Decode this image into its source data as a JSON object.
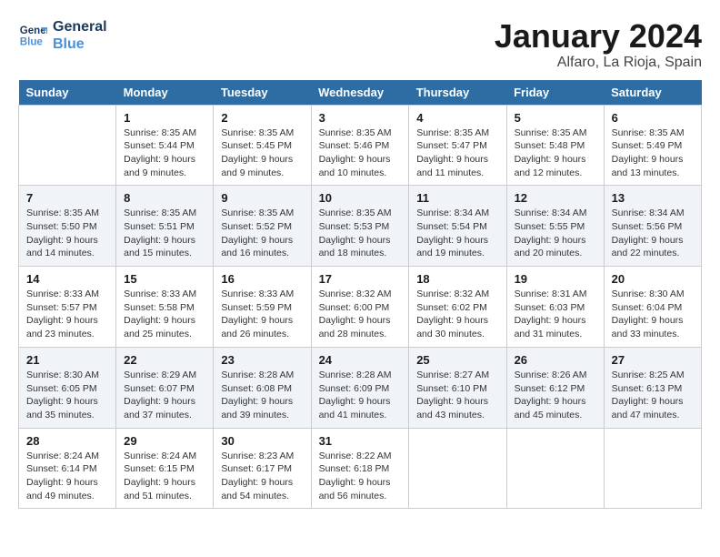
{
  "header": {
    "logo_line1": "General",
    "logo_line2": "Blue",
    "month_title": "January 2024",
    "location": "Alfaro, La Rioja, Spain"
  },
  "days_of_week": [
    "Sunday",
    "Monday",
    "Tuesday",
    "Wednesday",
    "Thursday",
    "Friday",
    "Saturday"
  ],
  "weeks": [
    [
      {
        "num": "",
        "info": ""
      },
      {
        "num": "1",
        "info": "Sunrise: 8:35 AM\nSunset: 5:44 PM\nDaylight: 9 hours\nand 9 minutes."
      },
      {
        "num": "2",
        "info": "Sunrise: 8:35 AM\nSunset: 5:45 PM\nDaylight: 9 hours\nand 9 minutes."
      },
      {
        "num": "3",
        "info": "Sunrise: 8:35 AM\nSunset: 5:46 PM\nDaylight: 9 hours\nand 10 minutes."
      },
      {
        "num": "4",
        "info": "Sunrise: 8:35 AM\nSunset: 5:47 PM\nDaylight: 9 hours\nand 11 minutes."
      },
      {
        "num": "5",
        "info": "Sunrise: 8:35 AM\nSunset: 5:48 PM\nDaylight: 9 hours\nand 12 minutes."
      },
      {
        "num": "6",
        "info": "Sunrise: 8:35 AM\nSunset: 5:49 PM\nDaylight: 9 hours\nand 13 minutes."
      }
    ],
    [
      {
        "num": "7",
        "info": "Sunrise: 8:35 AM\nSunset: 5:50 PM\nDaylight: 9 hours\nand 14 minutes."
      },
      {
        "num": "8",
        "info": "Sunrise: 8:35 AM\nSunset: 5:51 PM\nDaylight: 9 hours\nand 15 minutes."
      },
      {
        "num": "9",
        "info": "Sunrise: 8:35 AM\nSunset: 5:52 PM\nDaylight: 9 hours\nand 16 minutes."
      },
      {
        "num": "10",
        "info": "Sunrise: 8:35 AM\nSunset: 5:53 PM\nDaylight: 9 hours\nand 18 minutes."
      },
      {
        "num": "11",
        "info": "Sunrise: 8:34 AM\nSunset: 5:54 PM\nDaylight: 9 hours\nand 19 minutes."
      },
      {
        "num": "12",
        "info": "Sunrise: 8:34 AM\nSunset: 5:55 PM\nDaylight: 9 hours\nand 20 minutes."
      },
      {
        "num": "13",
        "info": "Sunrise: 8:34 AM\nSunset: 5:56 PM\nDaylight: 9 hours\nand 22 minutes."
      }
    ],
    [
      {
        "num": "14",
        "info": "Sunrise: 8:33 AM\nSunset: 5:57 PM\nDaylight: 9 hours\nand 23 minutes."
      },
      {
        "num": "15",
        "info": "Sunrise: 8:33 AM\nSunset: 5:58 PM\nDaylight: 9 hours\nand 25 minutes."
      },
      {
        "num": "16",
        "info": "Sunrise: 8:33 AM\nSunset: 5:59 PM\nDaylight: 9 hours\nand 26 minutes."
      },
      {
        "num": "17",
        "info": "Sunrise: 8:32 AM\nSunset: 6:00 PM\nDaylight: 9 hours\nand 28 minutes."
      },
      {
        "num": "18",
        "info": "Sunrise: 8:32 AM\nSunset: 6:02 PM\nDaylight: 9 hours\nand 30 minutes."
      },
      {
        "num": "19",
        "info": "Sunrise: 8:31 AM\nSunset: 6:03 PM\nDaylight: 9 hours\nand 31 minutes."
      },
      {
        "num": "20",
        "info": "Sunrise: 8:30 AM\nSunset: 6:04 PM\nDaylight: 9 hours\nand 33 minutes."
      }
    ],
    [
      {
        "num": "21",
        "info": "Sunrise: 8:30 AM\nSunset: 6:05 PM\nDaylight: 9 hours\nand 35 minutes."
      },
      {
        "num": "22",
        "info": "Sunrise: 8:29 AM\nSunset: 6:07 PM\nDaylight: 9 hours\nand 37 minutes."
      },
      {
        "num": "23",
        "info": "Sunrise: 8:28 AM\nSunset: 6:08 PM\nDaylight: 9 hours\nand 39 minutes."
      },
      {
        "num": "24",
        "info": "Sunrise: 8:28 AM\nSunset: 6:09 PM\nDaylight: 9 hours\nand 41 minutes."
      },
      {
        "num": "25",
        "info": "Sunrise: 8:27 AM\nSunset: 6:10 PM\nDaylight: 9 hours\nand 43 minutes."
      },
      {
        "num": "26",
        "info": "Sunrise: 8:26 AM\nSunset: 6:12 PM\nDaylight: 9 hours\nand 45 minutes."
      },
      {
        "num": "27",
        "info": "Sunrise: 8:25 AM\nSunset: 6:13 PM\nDaylight: 9 hours\nand 47 minutes."
      }
    ],
    [
      {
        "num": "28",
        "info": "Sunrise: 8:24 AM\nSunset: 6:14 PM\nDaylight: 9 hours\nand 49 minutes."
      },
      {
        "num": "29",
        "info": "Sunrise: 8:24 AM\nSunset: 6:15 PM\nDaylight: 9 hours\nand 51 minutes."
      },
      {
        "num": "30",
        "info": "Sunrise: 8:23 AM\nSunset: 6:17 PM\nDaylight: 9 hours\nand 54 minutes."
      },
      {
        "num": "31",
        "info": "Sunrise: 8:22 AM\nSunset: 6:18 PM\nDaylight: 9 hours\nand 56 minutes."
      },
      {
        "num": "",
        "info": ""
      },
      {
        "num": "",
        "info": ""
      },
      {
        "num": "",
        "info": ""
      }
    ]
  ]
}
